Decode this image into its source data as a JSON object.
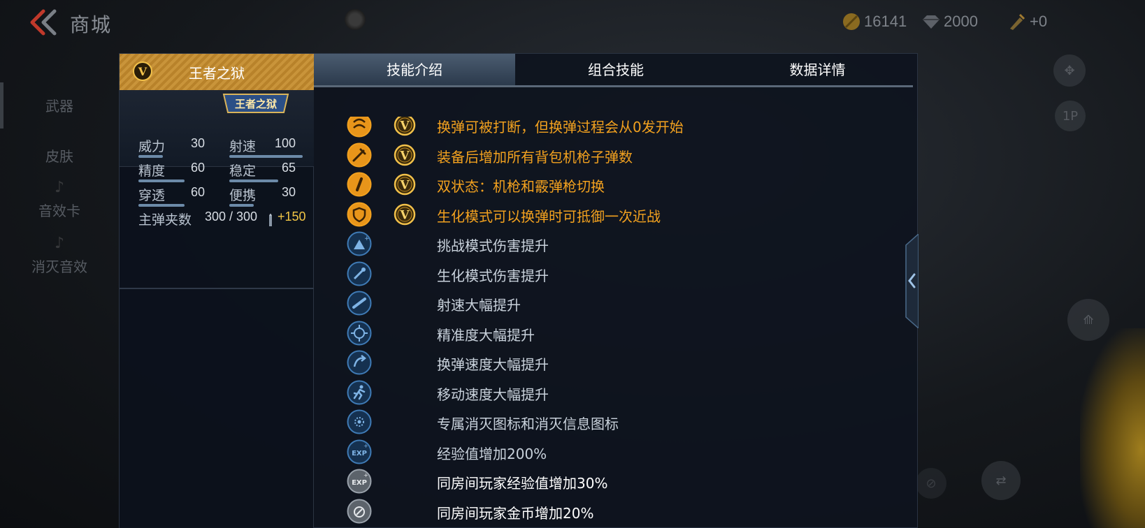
{
  "header": {
    "title": "商城"
  },
  "currencies": [
    {
      "name": "gold-coin-icon",
      "value": "16141"
    },
    {
      "name": "diamond-icon",
      "value": "2000"
    },
    {
      "name": "ticket-icon",
      "value": "+0"
    }
  ],
  "sidenav": {
    "items": [
      "武器",
      "皮肤",
      "音效卡",
      "消灭音效"
    ]
  },
  "right_buttons": {
    "view": "1P"
  },
  "weapon": {
    "name": "王者之狱",
    "logo_text": "王者之狱",
    "stats": [
      {
        "label": "威力",
        "value": "30",
        "level": 0.3
      },
      {
        "label": "射速",
        "value": "100",
        "level": 1.0
      },
      {
        "label": "精度",
        "value": "60",
        "level": 0.6
      },
      {
        "label": "稳定",
        "value": "65",
        "level": 0.65
      },
      {
        "label": "穿透",
        "value": "60",
        "level": 0.6
      },
      {
        "label": "便携",
        "value": "30",
        "level": 0.3
      }
    ],
    "ammo_label": "主弹夹数",
    "ammo_value": "300 / 300",
    "ammo_extra": "+150"
  },
  "tabs": [
    "技能介绍",
    "组合技能",
    "数据详情"
  ],
  "active_tab": 0,
  "colors": {
    "gold": "#f2a11f",
    "normal_text": "#c9d2dc",
    "white_text": "#ffffff",
    "accent_blue": "#4a7fb0"
  },
  "skills": [
    {
      "text": "换弹可被打断，但换弹过程会从0发开始",
      "icon": "reload-interrupt-icon",
      "badge": true,
      "style": "gold"
    },
    {
      "text": "装备后增加所有背包机枪子弹数",
      "icon": "machine-gun-ammo-icon",
      "badge": true,
      "style": "gold"
    },
    {
      "text": "双状态：机枪和霰弹枪切换",
      "icon": "dual-mode-icon",
      "badge": true,
      "style": "gold"
    },
    {
      "text": "生化模式可以换弹时可抵御一次近战",
      "icon": "shield-icon",
      "badge": true,
      "style": "gold"
    },
    {
      "text": "挑战模式伤害提升",
      "icon": "challenge-damage-icon",
      "badge": false,
      "style": "normal"
    },
    {
      "text": "生化模式伤害提升",
      "icon": "zombie-damage-icon",
      "badge": false,
      "style": "normal"
    },
    {
      "text": "射速大幅提升",
      "icon": "fire-rate-icon",
      "badge": false,
      "style": "normal"
    },
    {
      "text": "精准度大幅提升",
      "icon": "crosshair-icon",
      "badge": false,
      "style": "normal"
    },
    {
      "text": "换弹速度大幅提升",
      "icon": "reload-speed-icon",
      "badge": false,
      "style": "normal"
    },
    {
      "text": "移动速度大幅提升",
      "icon": "running-man-icon",
      "badge": false,
      "style": "normal"
    },
    {
      "text": "专属消灭图标和消灭信息图标",
      "icon": "kill-icon",
      "badge": false,
      "style": "normal"
    },
    {
      "text": "经验值增加200%",
      "icon": "exp-icon",
      "badge": false,
      "style": "normal"
    },
    {
      "text": "同房间玩家经验值增加30%",
      "icon": "room-exp-icon",
      "badge": false,
      "style": "white"
    },
    {
      "text": "同房间玩家金币增加20%",
      "icon": "room-coin-icon",
      "badge": false,
      "style": "white"
    }
  ]
}
